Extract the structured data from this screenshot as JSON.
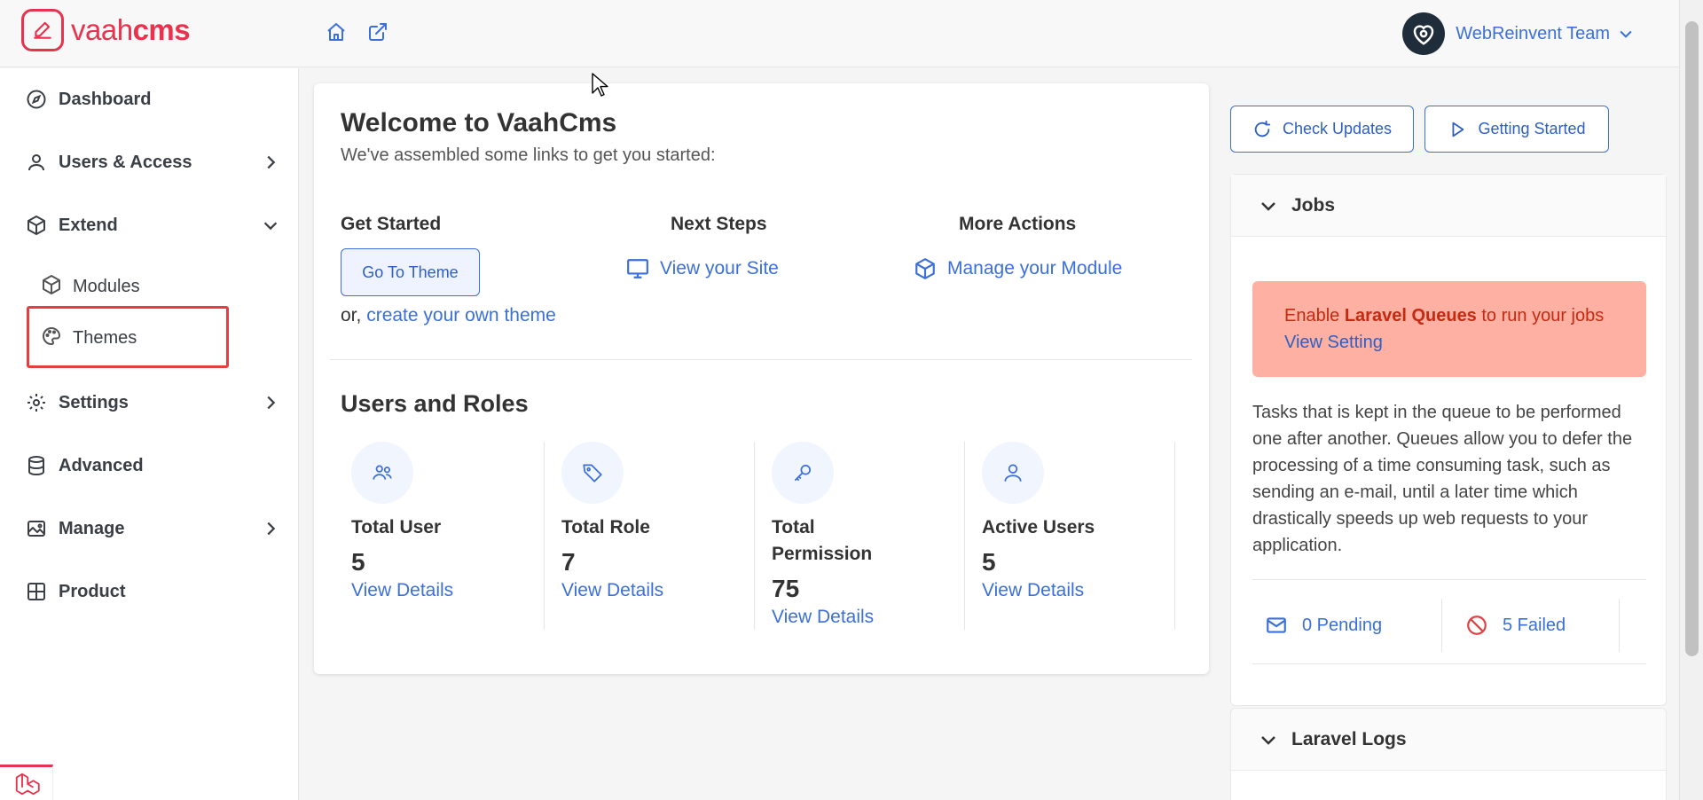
{
  "app": {
    "logo_light": "vaah",
    "logo_bold": "cms",
    "brand_color": "#e8334f",
    "accent_color": "#3b6fd9"
  },
  "header": {
    "home_icon": "home-icon",
    "external_icon": "external-link-icon",
    "user_name": "WebReinvent Team"
  },
  "sidebar": {
    "items": [
      {
        "label": "Dashboard",
        "icon": "compass-icon"
      },
      {
        "label": "Users & Access",
        "icon": "user-icon"
      },
      {
        "label": "Extend",
        "icon": "box-icon"
      },
      {
        "label": "Settings",
        "icon": "gear-icon"
      },
      {
        "label": "Advanced",
        "icon": "database-icon"
      },
      {
        "label": "Manage",
        "icon": "image-icon"
      },
      {
        "label": "Product",
        "icon": "grid-icon"
      }
    ],
    "sub_items": [
      {
        "label": "Modules",
        "icon": "box-icon"
      },
      {
        "label": "Themes",
        "icon": "palette-icon"
      }
    ]
  },
  "welcome": {
    "title": "Welcome to VaahCms",
    "subtitle": "We've assembled some links to get you started:",
    "get_started": {
      "heading": "Get Started",
      "button": "Go To Theme",
      "or_text": "or,",
      "create_link": "create your own theme"
    },
    "next_steps": {
      "heading": "Next Steps",
      "link": "View your Site"
    },
    "more_actions": {
      "heading": "More Actions",
      "link": "Manage your Module"
    }
  },
  "users_roles": {
    "title": "Users and Roles",
    "stats": [
      {
        "name": "Total User",
        "value": "5",
        "link": "View Details"
      },
      {
        "name": "Total Role",
        "value": "7",
        "link": "View Details"
      },
      {
        "name": "Total Permission",
        "value": "75",
        "link": "View Details"
      },
      {
        "name": "Active Users",
        "value": "5",
        "link": "View Details"
      }
    ]
  },
  "actions": {
    "check_updates": "Check Updates",
    "getting_started": "Getting Started"
  },
  "jobs": {
    "title": "Jobs",
    "alert_prefix": "Enable",
    "alert_bold": "Laravel Queues",
    "alert_suffix": "to run your jobs",
    "alert_link": "View Setting",
    "description": "Tasks that is kept in the queue to be performed one after another. Queues allow you to defer the processing of a time consuming task, such as sending an e-mail, until a later time which drastically speeds up web requests to your application.",
    "pending": "0 Pending",
    "failed": "5 Failed",
    "alert_bg": "#feb1a3",
    "alert_text_color": "#c42a11"
  },
  "logs": {
    "title": "Laravel Logs"
  }
}
